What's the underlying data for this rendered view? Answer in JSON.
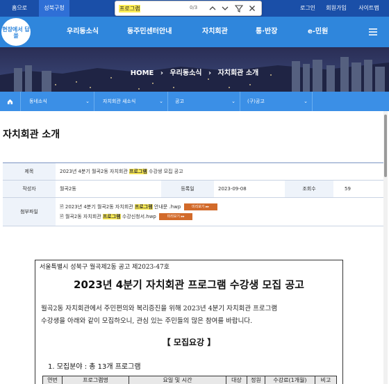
{
  "topbar": {
    "home": "홈으로",
    "seongbuk": "성북구청",
    "login": "로그인",
    "join": "회원가입",
    "sitemap": "사이트맵"
  },
  "findbar": {
    "query": "프로그램",
    "count": "0/3"
  },
  "logo": {
    "text": "현장에서 답을"
  },
  "nav": {
    "items": [
      "우리동소식",
      "동주민센터안내",
      "자치회관",
      "통·반장",
      "e-민원"
    ]
  },
  "breadcrumb": {
    "home": "HOME",
    "sep1": "›",
    "level1": "우리동소식",
    "sep2": "›",
    "level2": "자치회관 소개"
  },
  "subnav": {
    "items": [
      "동네소식",
      "자치회관 새소식",
      "공고",
      "(구)공고"
    ]
  },
  "page": {
    "title": "자치회관 소개"
  },
  "post": {
    "label_title": "제목",
    "title_pre": "2023년 4분기 월곡2동 자치회관 ",
    "title_hl": "프로그램",
    "title_post": " 수강생 모집 공고",
    "label_author": "작성자",
    "author": "월곡2동",
    "label_date": "등록일",
    "date": "2023-09-08",
    "label_views": "조회수",
    "views": "59",
    "label_attach": "첨부파일",
    "attachments": [
      {
        "pre": "2023년 4분기 월곡2동 자치회관 ",
        "hl": "프로그램",
        "post": " 안내문 .hwp",
        "button": "미리보기 ▸▸"
      },
      {
        "pre": "월곡2동 자치회관 ",
        "hl": "프로그램",
        "post": " 수강신청서.hwp",
        "button": "미리보기 ▸▸"
      }
    ]
  },
  "document": {
    "notice_no": "서울특별시 성북구 월곡제2동 공고 제2023-47호",
    "heading": "2023년 4분기 자치회관 프로그램 수강생 모집 공고",
    "intro_line1": "월곡2동 자치회관에서 주민편의와 복리증진을 위해 2023년 4분기 자치회관 프로그램",
    "intro_line2": "수강생을 아래와 같이 모집하오니, 관심 있는 주민들의 많은 참여를 바랍니다.",
    "section_title": "【  모집요강  】",
    "item1": "1. 모집분야 : 총 13개 프로그램",
    "table_headers": [
      "연번",
      "프로그램명",
      "요일 및 시간",
      "대상",
      "정원",
      "수강료(1개월)",
      "비고"
    ]
  },
  "colors": {
    "topbar": "#1a4fa8",
    "nav": "#2f86dc",
    "subnav": "#3b8fe6",
    "highlight": "#ffee55",
    "download_button": "#d26a2a"
  }
}
